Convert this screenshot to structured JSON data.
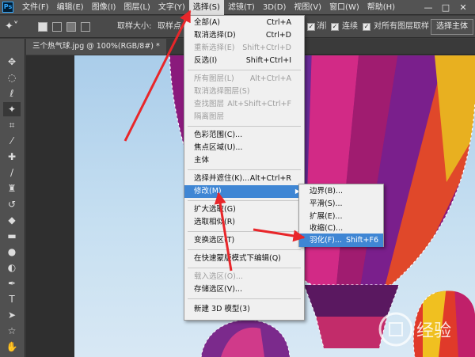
{
  "menubar": {
    "logo": "Ps",
    "items": [
      "文件(F)",
      "编辑(E)",
      "图像(I)",
      "图层(L)",
      "文字(Y)",
      "选择(S)",
      "滤镜(T)",
      "3D(D)",
      "视图(V)",
      "窗口(W)",
      "帮助(H)"
    ],
    "active_index": 5,
    "controls": [
      "—",
      "□",
      "✕"
    ]
  },
  "options": {
    "sample_size_label": "取样大小:",
    "sample_size_value": "取样点",
    "antialias_label": "消除锯齿",
    "contiguous_label": "连续",
    "sample_all_label": "对所有图层取样",
    "select_subject_button": "选择主体"
  },
  "document": {
    "tab_title": "三个热气球.jpg @ 100%(RGB/8#) *",
    "close": "×"
  },
  "select_menu": {
    "items": [
      {
        "label": "全部(A)",
        "shortcut": "Ctrl+A",
        "disabled": false
      },
      {
        "label": "取消选择(D)",
        "shortcut": "Ctrl+D",
        "disabled": false
      },
      {
        "label": "重新选择(E)",
        "shortcut": "Shift+Ctrl+D",
        "disabled": true
      },
      {
        "label": "反选(I)",
        "shortcut": "Shift+Ctrl+I",
        "disabled": false
      },
      {
        "label": "所有图层(L)",
        "shortcut": "Alt+Ctrl+A",
        "disabled": true
      },
      {
        "label": "取消选择图层(S)",
        "shortcut": "",
        "disabled": true
      },
      {
        "label": "查找图层",
        "shortcut": "Alt+Shift+Ctrl+F",
        "disabled": true
      },
      {
        "label": "隔离图层",
        "shortcut": "",
        "disabled": true
      },
      {
        "label": "色彩范围(C)...",
        "shortcut": "",
        "disabled": false
      },
      {
        "label": "焦点区域(U)...",
        "shortcut": "",
        "disabled": false
      },
      {
        "label": "主体",
        "shortcut": "",
        "disabled": false
      },
      {
        "label": "选择并遮住(K)...",
        "shortcut": "Alt+Ctrl+R",
        "disabled": false
      },
      {
        "label": "修改(M)",
        "shortcut": "",
        "disabled": false,
        "submenu": true
      },
      {
        "label": "扩大选取(G)",
        "shortcut": "",
        "disabled": false
      },
      {
        "label": "选取相似(R)",
        "shortcut": "",
        "disabled": false
      },
      {
        "label": "变换选区(T)",
        "shortcut": "",
        "disabled": false
      },
      {
        "label": "在快速蒙版模式下编辑(Q)",
        "shortcut": "",
        "disabled": false
      },
      {
        "label": "载入选区(O)...",
        "shortcut": "",
        "disabled": true
      },
      {
        "label": "存储选区(V)...",
        "shortcut": "",
        "disabled": false
      },
      {
        "label": "新建 3D 模型(3)",
        "shortcut": "",
        "disabled": false
      }
    ]
  },
  "modify_submenu": {
    "items": [
      {
        "label": "边界(B)...",
        "shortcut": ""
      },
      {
        "label": "平滑(S)...",
        "shortcut": ""
      },
      {
        "label": "扩展(E)...",
        "shortcut": ""
      },
      {
        "label": "收缩(C)...",
        "shortcut": ""
      },
      {
        "label": "羽化(F)...",
        "shortcut": "Shift+F6"
      }
    ]
  },
  "watermark": {
    "text": "经验"
  },
  "colors": {
    "menu_highlight": "#3f86d4",
    "arrow_red": "#e8262a",
    "panel_dark": "#535353"
  }
}
